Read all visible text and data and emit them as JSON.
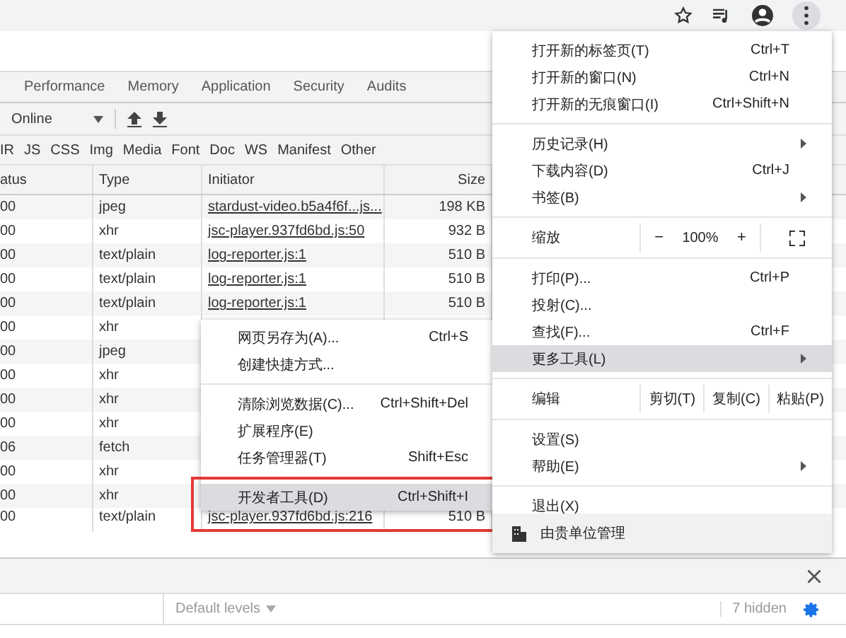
{
  "browser_toolbar": {
    "menu_button": {
      "selected": true
    }
  },
  "devtools": {
    "tabs": [
      {
        "label": "Performance",
        "selected": false
      },
      {
        "label": "Memory",
        "selected": false
      },
      {
        "label": "Application",
        "selected": false
      },
      {
        "label": "Security",
        "selected": false
      },
      {
        "label": "Audits",
        "selected": false
      }
    ],
    "throttling": {
      "value": "Online"
    },
    "filters": [
      "IR",
      "JS",
      "CSS",
      "Img",
      "Media",
      "Font",
      "Doc",
      "WS",
      "Manifest",
      "Other"
    ],
    "table": {
      "columns": [
        "atus",
        "Type",
        "Initiator",
        "Size"
      ],
      "rows": [
        {
          "status": "00",
          "type": "jpeg",
          "initiator": "stardust-video.b5a4f6f...js...",
          "size": "198 KB"
        },
        {
          "status": "00",
          "type": "xhr",
          "initiator": "jsc-player.937fd6bd.js:50",
          "size": "932 B"
        },
        {
          "status": "00",
          "type": "text/plain",
          "initiator": "log-reporter.js:1",
          "size": "510 B"
        },
        {
          "status": "00",
          "type": "text/plain",
          "initiator": "log-reporter.js:1",
          "size": "510 B"
        },
        {
          "status": "00",
          "type": "text/plain",
          "initiator": "log-reporter.js:1",
          "size": "510 B"
        },
        {
          "status": "00",
          "type": "xhr"
        },
        {
          "status": "00",
          "type": "jpeg"
        },
        {
          "status": "00",
          "type": "xhr"
        },
        {
          "status": "00",
          "type": "xhr"
        },
        {
          "status": "00",
          "type": "xhr"
        },
        {
          "status": "06",
          "type": "fetch"
        },
        {
          "status": "00",
          "type": "xhr"
        },
        {
          "status": "00",
          "type": "xhr"
        },
        {
          "status": "00",
          "type": "text/plain",
          "initiator": "jsc-player.937fd6bd.js:216",
          "size": "510 B"
        }
      ]
    },
    "console": {
      "levels": "Default levels",
      "hidden": "7 hidden"
    }
  },
  "main_menu": {
    "items": [
      {
        "kind": "item",
        "label": "打开新的标签页(T)",
        "shortcut": "Ctrl+T",
        "submenu": false,
        "selected": false
      },
      {
        "kind": "item",
        "label": "打开新的窗口(N)",
        "shortcut": "Ctrl+N",
        "submenu": false,
        "selected": false
      },
      {
        "kind": "item",
        "label": "打开新的无痕窗口(I)",
        "shortcut": "Ctrl+Shift+N",
        "submenu": false,
        "selected": false
      },
      {
        "kind": "separator"
      },
      {
        "kind": "item",
        "label": "历史记录(H)",
        "submenu": true,
        "selected": false
      },
      {
        "kind": "item",
        "label": "下载内容(D)",
        "shortcut": "Ctrl+J",
        "submenu": false,
        "selected": false
      },
      {
        "kind": "item",
        "label": "书签(B)",
        "submenu": true,
        "selected": false
      },
      {
        "kind": "separator"
      },
      {
        "kind": "zoom",
        "label": "缩放",
        "minus": "−",
        "value": "100%",
        "plus": "+"
      },
      {
        "kind": "separator"
      },
      {
        "kind": "item",
        "label": "打印(P)...",
        "shortcut": "Ctrl+P",
        "submenu": false,
        "selected": false
      },
      {
        "kind": "item",
        "label": "投射(C)...",
        "submenu": false,
        "selected": false
      },
      {
        "kind": "item",
        "label": "查找(F)...",
        "shortcut": "Ctrl+F",
        "submenu": false,
        "selected": false
      },
      {
        "kind": "item",
        "label": "更多工具(L)",
        "submenu": true,
        "selected": true
      },
      {
        "kind": "separator"
      },
      {
        "kind": "edit",
        "label": "编辑",
        "buttons": [
          "剪切(T)",
          "复制(C)",
          "粘贴(P)"
        ]
      },
      {
        "kind": "separator"
      },
      {
        "kind": "item",
        "label": "设置(S)",
        "submenu": false,
        "selected": false
      },
      {
        "kind": "item",
        "label": "帮助(E)",
        "submenu": true,
        "selected": false
      },
      {
        "kind": "separator"
      },
      {
        "kind": "item",
        "label": "退出(X)",
        "submenu": false,
        "selected": false
      },
      {
        "kind": "managed",
        "label": "由贵单位管理"
      }
    ]
  },
  "more_tools_menu": {
    "items": [
      {
        "kind": "item",
        "label": "网页另存为(A)...",
        "shortcut": "Ctrl+S",
        "selected": false
      },
      {
        "kind": "item",
        "label": "创建快捷方式...",
        "selected": false
      },
      {
        "kind": "separator"
      },
      {
        "kind": "item",
        "label": "清除浏览数据(C)...",
        "shortcut": "Ctrl+Shift+Del",
        "selected": false
      },
      {
        "kind": "item",
        "label": "扩展程序(E)",
        "selected": false
      },
      {
        "kind": "item",
        "label": "任务管理器(T)",
        "shortcut": "Shift+Esc",
        "selected": false
      },
      {
        "kind": "separator"
      },
      {
        "kind": "item",
        "label": "开发者工具(D)",
        "shortcut": "Ctrl+Shift+I",
        "selected": true
      }
    ]
  }
}
